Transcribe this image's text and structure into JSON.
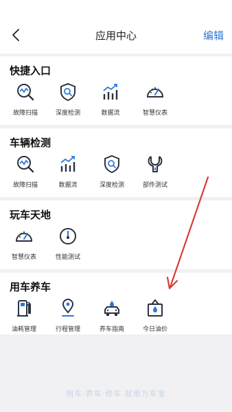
{
  "header": {
    "title": "应用中心",
    "edit_label": "编辑"
  },
  "sections": [
    {
      "title": "快捷入口",
      "items": [
        {
          "label": "故障扫描",
          "icon": "fault-scan-icon"
        },
        {
          "label": "深度检测",
          "icon": "deep-check-icon"
        },
        {
          "label": "数据流",
          "icon": "data-flow-icon"
        },
        {
          "label": "智慧仪表",
          "icon": "gauge-icon"
        }
      ]
    },
    {
      "title": "车辆检测",
      "items": [
        {
          "label": "故障扫描",
          "icon": "fault-scan-icon"
        },
        {
          "label": "数据流",
          "icon": "data-flow-icon"
        },
        {
          "label": "深度检测",
          "icon": "deep-check-icon"
        },
        {
          "label": "部件测试",
          "icon": "wrench-icon"
        }
      ]
    },
    {
      "title": "玩车天地",
      "items": [
        {
          "label": "智慧仪表",
          "icon": "gauge-icon"
        },
        {
          "label": "性能测试",
          "icon": "performance-icon"
        }
      ]
    },
    {
      "title": "用车养车",
      "items": [
        {
          "label": "油耗管理",
          "icon": "fuel-pump-icon"
        },
        {
          "label": "行程管理",
          "icon": "location-pin-icon"
        },
        {
          "label": "养车指南",
          "icon": "car-care-icon"
        },
        {
          "label": "今日油价",
          "icon": "oil-price-sign-icon"
        }
      ]
    }
  ],
  "footer": {
    "slogan": "用车·养车·修车 就用万车宝"
  },
  "colors": {
    "accent": "#2f78d6",
    "icon_dark": "#2a3140",
    "arrow": "#d93b34"
  }
}
